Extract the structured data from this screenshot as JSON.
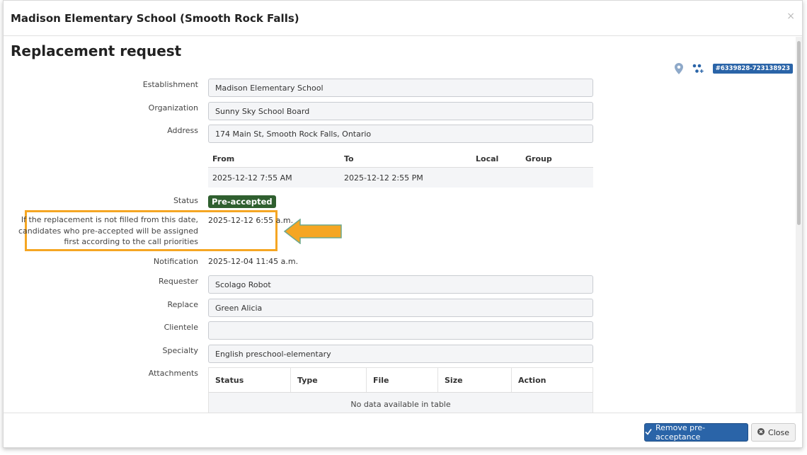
{
  "modal": {
    "title": "Madison Elementary School (Smooth Rock Falls)",
    "close_glyph": "×"
  },
  "page": {
    "title": "Replacement request",
    "reference": "#6339828-723138923",
    "icons": [
      "map-pin-icon",
      "people-network-icon"
    ]
  },
  "fields": {
    "establishment": {
      "label": "Establishment",
      "value": "Madison Elementary School"
    },
    "organization": {
      "label": "Organization",
      "value": "Sunny Sky School Board"
    },
    "address": {
      "label": "Address",
      "value": "174 Main St, Smooth Rock Falls, Ontario"
    },
    "requester": {
      "label": "Requester",
      "value": "Scolago Robot"
    },
    "replace": {
      "label": "Replace",
      "value": "Green Alicia"
    },
    "clientele": {
      "label": "Clientele",
      "value": ""
    },
    "specialty": {
      "label": "Specialty",
      "value": "English preschool-elementary"
    }
  },
  "schedule": {
    "headers": [
      "From",
      "To",
      "Local",
      "Group"
    ],
    "rows": [
      {
        "from": "2025-12-12 7:55 AM",
        "to": "2025-12-12 2:55 PM",
        "local": "",
        "group": ""
      }
    ]
  },
  "status": {
    "label": "Status",
    "value": "Pre-accepted",
    "color": "#2f5f2f"
  },
  "preaccept_deadline": {
    "label": "If the replacement is not filled from this date, candidates who pre-accepted will be assigned first according to the call priorities",
    "value": "2025-12-12 6:55 a.m."
  },
  "notification": {
    "label": "Notification",
    "value": "2025-12-04 11:45 a.m."
  },
  "attachments": {
    "label": "Attachments",
    "headers": [
      "Status",
      "Type",
      "File",
      "Size",
      "Action"
    ],
    "empty_text": "No data available in table"
  },
  "footer": {
    "primary_label": "Remove pre-acceptance",
    "close_label": "Close"
  },
  "colors": {
    "accent": "#2a64a8",
    "highlight": "#f5a623",
    "status_green": "#2f5f2f"
  }
}
